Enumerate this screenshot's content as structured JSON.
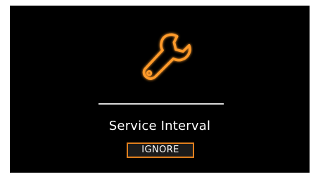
{
  "notification": {
    "title": "Service Interval",
    "icon": "wrench-icon",
    "ignore_label": "IGNORE"
  },
  "colors": {
    "background": "#000000",
    "accent_orange": "#e07f1e",
    "glow_orange": "#ff9a2a",
    "text": "#ffffff",
    "divider": "#d9d9d9"
  }
}
